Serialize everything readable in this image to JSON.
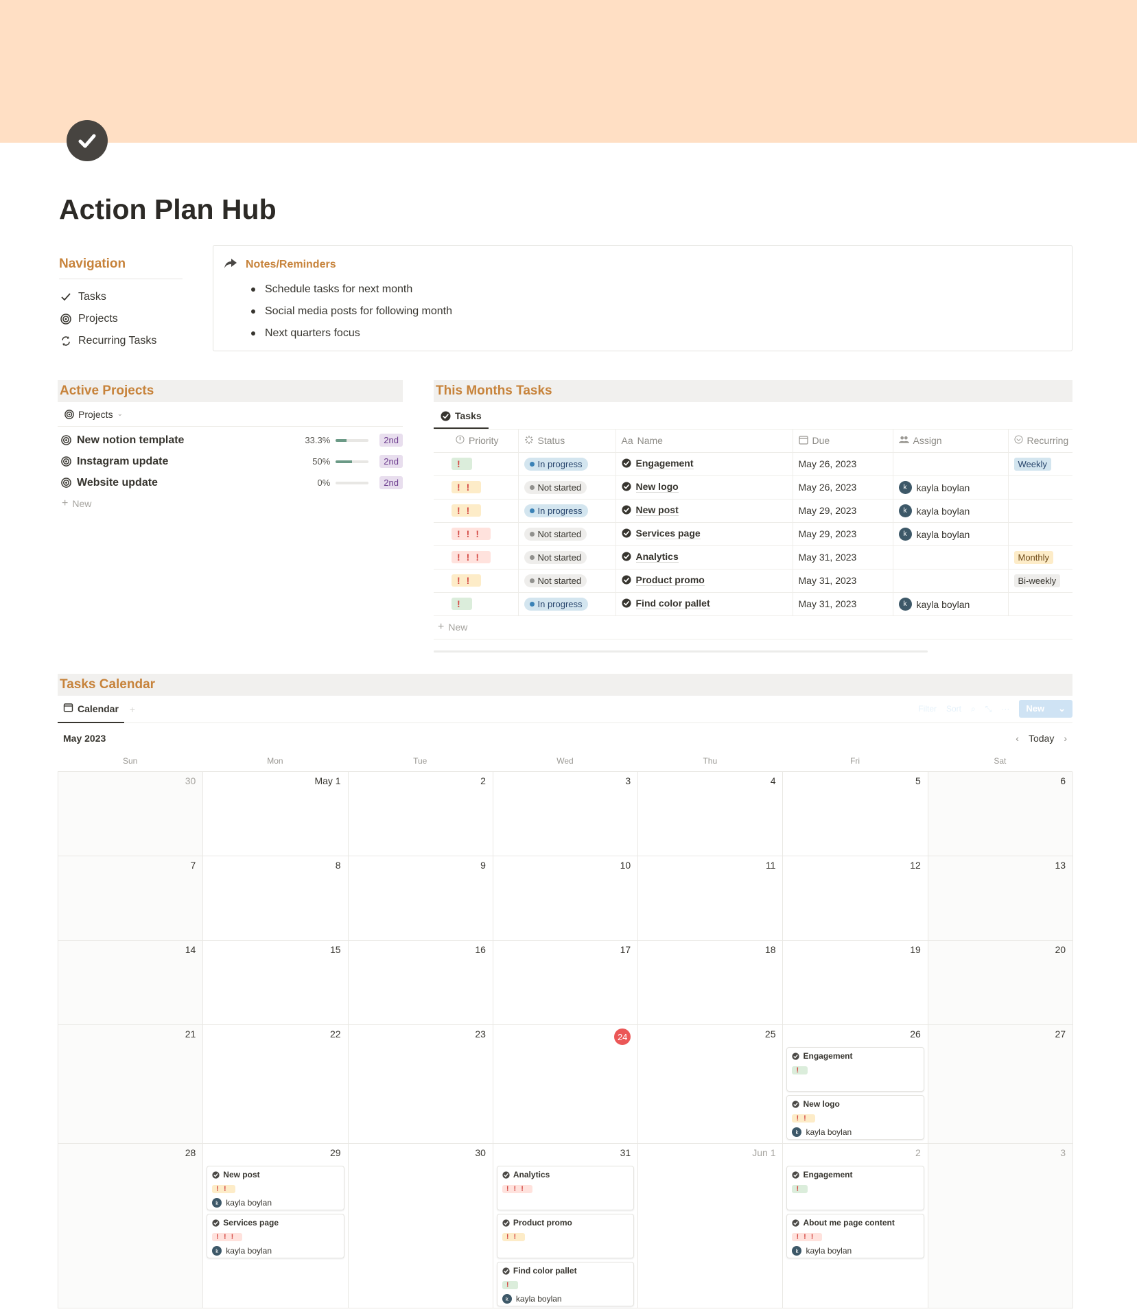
{
  "page": {
    "title": "Action Plan Hub",
    "icon": "check-circle-icon",
    "cover_color": "#ffdfc4"
  },
  "navigation": {
    "title": "Navigation",
    "items": [
      {
        "label": "Tasks",
        "icon": "checkmark-icon"
      },
      {
        "label": "Projects",
        "icon": "target-icon"
      },
      {
        "label": "Recurring Tasks",
        "icon": "repeat-icon"
      }
    ]
  },
  "notes": {
    "title": "Notes/Reminders",
    "icon": "share-arrow-icon",
    "items": [
      "Schedule tasks for next month",
      "Social media posts for following month",
      "Next quarters focus"
    ]
  },
  "active_projects": {
    "title": "Active Projects",
    "view_label": "Projects",
    "rows": [
      {
        "name": "New notion template",
        "percent": "33.3%",
        "progress": 0.333,
        "tag": "2nd"
      },
      {
        "name": "Instagram update",
        "percent": "50%",
        "progress": 0.5,
        "tag": "2nd"
      },
      {
        "name": "Website update",
        "percent": "0%",
        "progress": 0,
        "tag": "2nd"
      }
    ],
    "new_label": "New"
  },
  "months_tasks": {
    "title": "This Months Tasks",
    "view_label": "Tasks",
    "columns": {
      "priority": "Priority",
      "status": "Status",
      "name": "Name",
      "name_prefix": "Aa",
      "due": "Due",
      "assign": "Assign",
      "recurring": "Recurring"
    },
    "rows": [
      {
        "priority": "!",
        "status": "In progress",
        "name": "Engagement",
        "due": "May 26, 2023",
        "assign": "",
        "recurring": "Weekly"
      },
      {
        "priority": "!!",
        "status": "Not started",
        "name": "New logo",
        "due": "May 26, 2023",
        "assign": "kayla boylan",
        "recurring": ""
      },
      {
        "priority": "!!",
        "status": "In progress",
        "name": "New post",
        "due": "May 29, 2023",
        "assign": "kayla boylan",
        "recurring": ""
      },
      {
        "priority": "!!!",
        "status": "Not started",
        "name": "Services page",
        "due": "May 29, 2023",
        "assign": "kayla boylan",
        "recurring": ""
      },
      {
        "priority": "!!!",
        "status": "Not started",
        "name": "Analytics",
        "due": "May 31, 2023",
        "assign": "",
        "recurring": "Monthly"
      },
      {
        "priority": "!!",
        "status": "Not started",
        "name": "Product promo",
        "due": "May 31, 2023",
        "assign": "",
        "recurring": "Bi-weekly"
      },
      {
        "priority": "!",
        "status": "In progress",
        "name": "Find color pallet",
        "due": "May 31, 2023",
        "assign": "kayla boylan",
        "recurring": ""
      }
    ],
    "new_label": "New",
    "avatar_initial": "k"
  },
  "calendar": {
    "title": "Tasks Calendar",
    "view_label": "Calendar",
    "add_tab": "+",
    "tools": [
      "Filter",
      "Sort"
    ],
    "new_button": "New",
    "month": "May 2023",
    "today_label": "Today",
    "weekdays": [
      "Sun",
      "Mon",
      "Tue",
      "Wed",
      "Thu",
      "Fri",
      "Sat"
    ],
    "weeks": [
      [
        {
          "d": "30",
          "other": true
        },
        {
          "d": "May 1"
        },
        {
          "d": "2"
        },
        {
          "d": "3"
        },
        {
          "d": "4"
        },
        {
          "d": "5"
        },
        {
          "d": "6"
        }
      ],
      [
        {
          "d": "7"
        },
        {
          "d": "8"
        },
        {
          "d": "9"
        },
        {
          "d": "10"
        },
        {
          "d": "11"
        },
        {
          "d": "12"
        },
        {
          "d": "13"
        }
      ],
      [
        {
          "d": "14"
        },
        {
          "d": "15"
        },
        {
          "d": "16"
        },
        {
          "d": "17"
        },
        {
          "d": "18"
        },
        {
          "d": "19"
        },
        {
          "d": "20"
        }
      ],
      [
        {
          "d": "21"
        },
        {
          "d": "22"
        },
        {
          "d": "23"
        },
        {
          "d": "24",
          "today": true
        },
        {
          "d": "25"
        },
        {
          "d": "26",
          "events": [
            {
              "name": "Engagement",
              "priority": "!"
            },
            {
              "name": "New logo",
              "priority": "!!",
              "assign": "kayla boylan"
            }
          ]
        },
        {
          "d": "27"
        }
      ],
      [
        {
          "d": "28"
        },
        {
          "d": "29",
          "events": [
            {
              "name": "New post",
              "priority": "!!",
              "assign": "kayla boylan"
            },
            {
              "name": "Services page",
              "priority": "!!!",
              "assign": "kayla boylan"
            }
          ]
        },
        {
          "d": "30"
        },
        {
          "d": "31",
          "events": [
            {
              "name": "Analytics",
              "priority": "!!!"
            },
            {
              "name": "Product promo",
              "priority": "!!"
            },
            {
              "name": "Find color pallet",
              "priority": "!",
              "assign": "kayla boylan"
            }
          ]
        },
        {
          "d": "Jun 1",
          "other": true
        },
        {
          "d": "2",
          "other": true,
          "events": [
            {
              "name": "Engagement",
              "priority": "!"
            },
            {
              "name": "About me page content",
              "priority": "!!!",
              "assign": "kayla boylan"
            }
          ]
        },
        {
          "d": "3",
          "other": true
        }
      ]
    ]
  }
}
